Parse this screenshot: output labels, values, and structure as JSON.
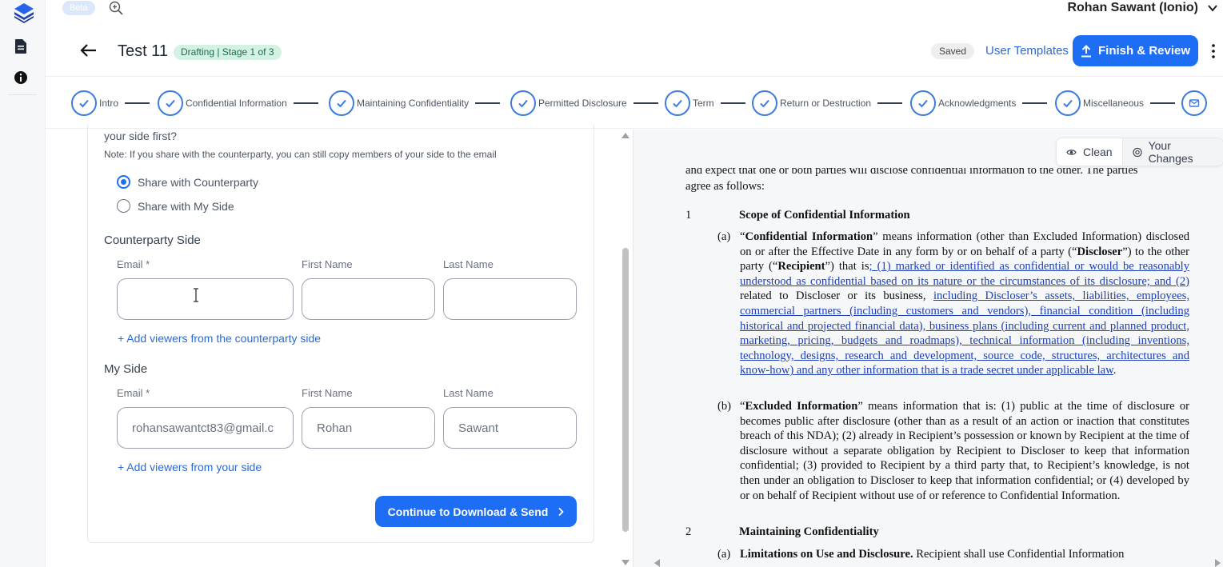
{
  "topbar": {
    "beta_label": "Beta",
    "user_name": "Rohan Sawant (Ionio)"
  },
  "header": {
    "title": "Test 11",
    "stage": "Drafting | Stage 1 of 3",
    "saved": "Saved",
    "user_templates": "User Templates",
    "finish_label": "Finish & Review"
  },
  "stepper": {
    "steps": [
      {
        "label": "Intro"
      },
      {
        "label": "Confidential Information"
      },
      {
        "label": "Maintaining Confidentiality"
      },
      {
        "label": "Permitted Disclosure"
      },
      {
        "label": "Term"
      },
      {
        "label": "Return or Destruction"
      },
      {
        "label": "Acknowledgments"
      },
      {
        "label": "Miscellaneous"
      }
    ]
  },
  "form": {
    "question_tail": "your side first?",
    "note": "Note: If you share with the counterparty, you can still copy members of your side to the email",
    "radio_counterparty": "Share with Counterparty",
    "radio_myside": "Share with My Side",
    "counterparty": {
      "title": "Counterparty Side",
      "email_label": "Email *",
      "first_label": "First Name",
      "last_label": "Last Name",
      "email_value": "",
      "first_value": "",
      "last_value": "",
      "add_link": "+ Add viewers from the counterparty side"
    },
    "myside": {
      "title": "My Side",
      "email_label": "Email *",
      "first_label": "First Name",
      "last_label": "Last Name",
      "email_value": "rohansawantct83@gmail.c",
      "first_value": "Rohan",
      "last_value": "Sawant",
      "add_link": "+ Add viewers from your side"
    },
    "continue_label": "Continue to Download & Send"
  },
  "viewer": {
    "clean_label": "Clean",
    "changes_label": "Your Changes"
  },
  "document": {
    "clipped_top": "and expect that one or both parties will disclose confidential information to the other. The parties",
    "intro_tail": "agree as follows:",
    "sec1_num": "1",
    "sec1_title": "Scope of Confidential Information",
    "a_letter": "(a)",
    "a_open": "“",
    "a_term": "Confidential Information",
    "a_text1": "” means information (other than Excluded Information) disclosed on or after the Effective Date in any form by or on behalf of a party (“",
    "a_disc": "Discloser",
    "a_text2": "”) to the other party (“",
    "a_rec": "Recipient",
    "a_text3": "”) that is",
    "a_ins1": "; (1) marked or identified as confidential or would be reasonably understood as confidential based on its nature or the circumstances of its disclosure; and (2)",
    "a_text4": " related to Discloser or its business, ",
    "a_ins2": "including Discloser’s assets, liabilities, employees, commercial partners (including customers and vendors), financial condition (including historical and projected financial data), business plans (including current and planned product, marketing, pricing, budgets and roadmaps), technical information (including inventions, technology, designs, research and development, source code, structures, architectures and know-how) and any other information that is a trade secret under applicable law",
    "a_end": ".",
    "b_letter": "(b)",
    "b_open": "“",
    "b_term": "Excluded Information",
    "b_text": "” means information that is: (1) public at the time of disclosure or becomes public after disclosure (other than as a result of an action or inaction that constitutes breach of this NDA); (2) already in Recipient’s possession or known by Recipient at the time of disclosure without a separate obligation by Recipient to Discloser to keep that information confidential; (3) provided to Recipient by a third party that, to Recipient’s knowledge, is not then under an obligation to Discloser to keep that information confidential; or (4) developed by or on behalf of Recipient without use of or reference to Confidential Information.",
    "sec2_num": "2",
    "sec2_title": "Maintaining Confidentiality",
    "c_letter": "(a)",
    "c_term": "Limitations on Use and Disclosure.",
    "c_text": " Recipient shall use Confidential Information"
  },
  "colors": {
    "primary": "#1e6ef5",
    "link": "#2a6ad8",
    "stage_bg": "#d3f2e4",
    "inserted_text": "#1d3fb8"
  }
}
